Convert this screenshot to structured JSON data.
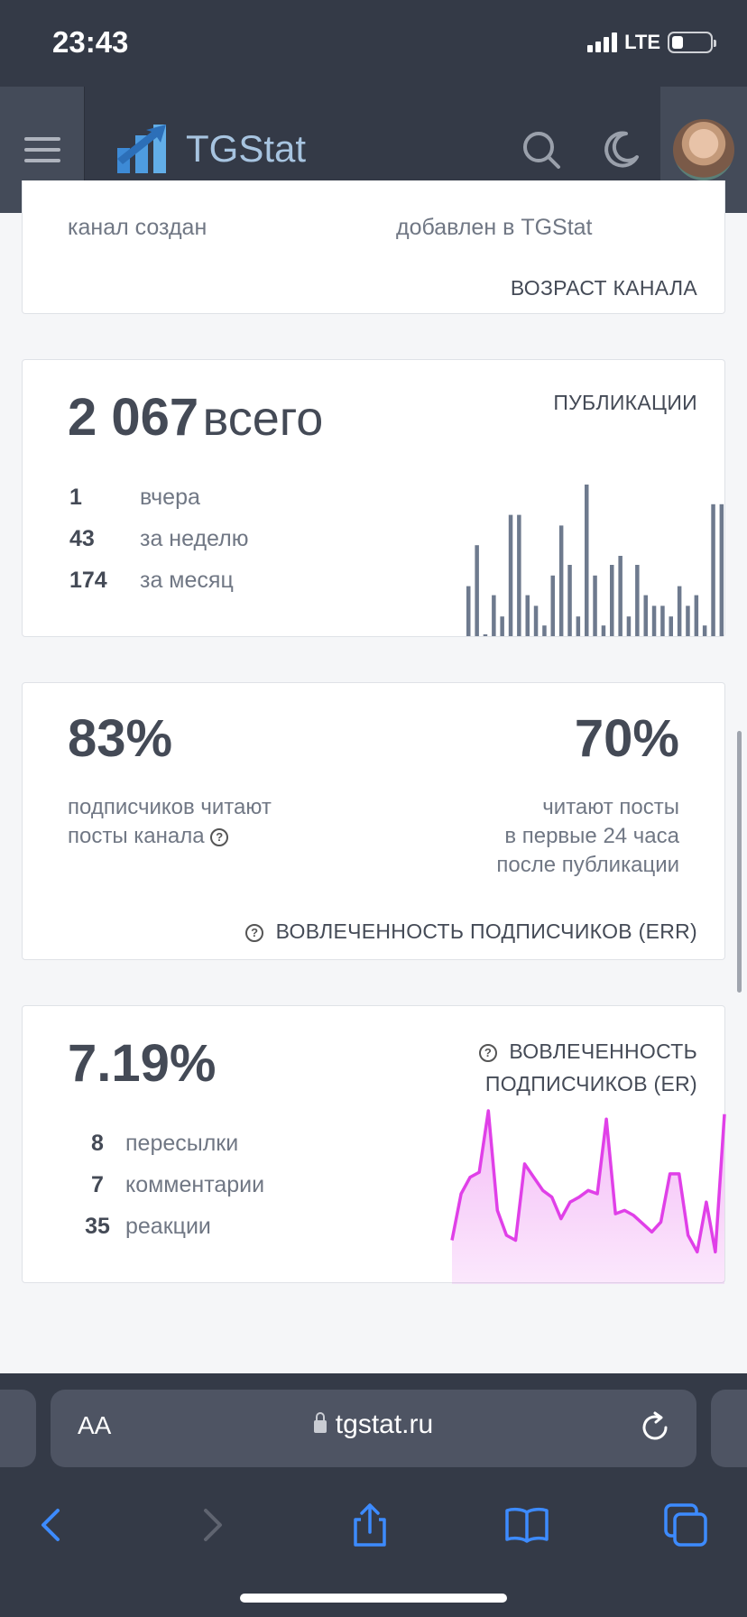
{
  "status_bar": {
    "time": "23:43",
    "network": "LTE"
  },
  "header": {
    "logo_text": "TGStat"
  },
  "age_card": {
    "created_label": "канал создан",
    "added_label": "добавлен в TGStat",
    "title": "ВОЗРАСТ КАНАЛА"
  },
  "posts_card": {
    "total_value": "2 067",
    "total_suffix": "всего",
    "title": "ПУБЛИКАЦИИ",
    "stats": [
      {
        "value": "1",
        "label": "вчера"
      },
      {
        "value": "43",
        "label": "за неделю"
      },
      {
        "value": "174",
        "label": "за месяц"
      }
    ],
    "bars": [
      0.33,
      0.6,
      0,
      0.27,
      0.13,
      0.8,
      0.8,
      0.27,
      0.2,
      0.07,
      0.4,
      0.73,
      0.47,
      0.13,
      1.0,
      0.4,
      0.07,
      0.47,
      0.53,
      0.13,
      0.47,
      0.27,
      0.2,
      0.2,
      0.13,
      0.33,
      0.2,
      0.27,
      0.07,
      0.87,
      0.87
    ]
  },
  "err_card": {
    "left_value": "83%",
    "left_text_1": "подписчиков читают",
    "left_text_2": "посты канала",
    "right_value": "70%",
    "right_text_1": "читают посты",
    "right_text_2": "в первые 24 часа",
    "right_text_3": "после публикации",
    "title": "ВОВЛЕЧЕННОСТЬ ПОДПИСЧИКОВ (ERR)"
  },
  "er_card": {
    "value": "7.19%",
    "title_1": "ВОВЛЕЧЕННОСТЬ",
    "title_2": "ПОДПИСЧИКОВ (ER)",
    "stats": [
      {
        "value": "8",
        "label": "пересылки"
      },
      {
        "value": "7",
        "label": "комментарии"
      },
      {
        "value": "35",
        "label": "реакции"
      }
    ],
    "series": [
      0.22,
      0.5,
      0.6,
      0.63,
      1.0,
      0.4,
      0.25,
      0.22,
      0.68,
      0.6,
      0.52,
      0.48,
      0.35,
      0.45,
      0.48,
      0.52,
      0.5,
      0.95,
      0.38,
      0.4,
      0.37,
      0.32,
      0.27,
      0.33,
      0.62,
      0.62,
      0.25,
      0.15,
      0.45,
      0.15,
      0.98
    ],
    "accent": "#e040e8"
  },
  "safari": {
    "aa_label": "AA",
    "url": "tgstat.ru"
  }
}
